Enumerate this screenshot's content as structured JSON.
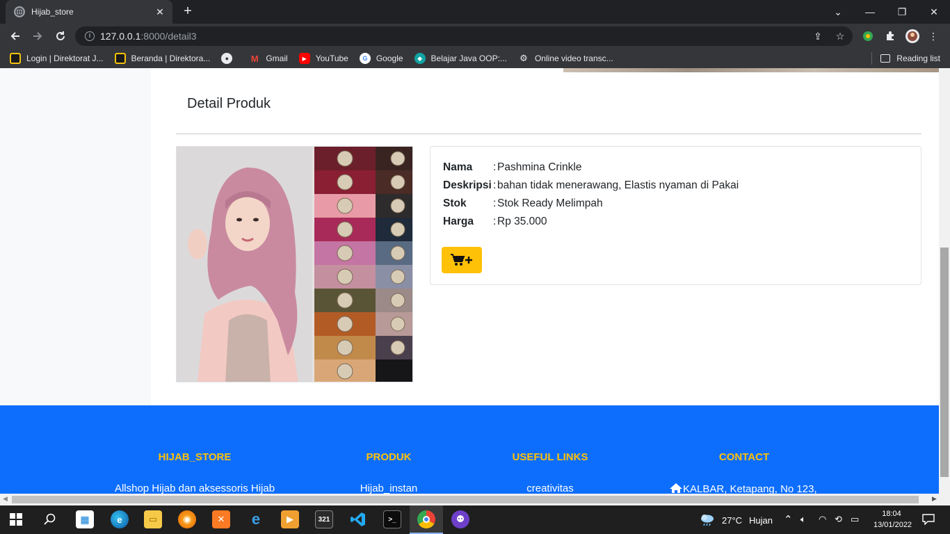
{
  "browser": {
    "tab_title": "Hijab_store",
    "url_host": "127.0.0.1",
    "url_path": ":8000/detail3",
    "bookmarks": [
      {
        "label": "Login | Direktorat J...",
        "color": "#f4c20d"
      },
      {
        "label": "Beranda | Direktora...",
        "color": "#f4c20d"
      },
      {
        "label": "",
        "color": "#e8eaed"
      },
      {
        "label": "Gmail",
        "color": "#ea4335"
      },
      {
        "label": "YouTube",
        "color": "#ff0000"
      },
      {
        "label": "Google",
        "color": "#4285f4"
      },
      {
        "label": "Belajar Java OOP:...",
        "color": "#12a4a4"
      },
      {
        "label": "Online video transc...",
        "color": "#5f6368"
      }
    ],
    "reading_list": "Reading list"
  },
  "page": {
    "section_title": "Detail Produk",
    "product": {
      "rows": [
        {
          "key": "Nama",
          "sep": ":",
          "value": "Pashmina Crinkle"
        },
        {
          "key": "Deskripsi",
          "sep": ":",
          "value": "bahan tidak menerawang, Elastis nyaman di Pakai"
        },
        {
          "key": "Stok",
          "sep": ":",
          "value": "Stok Ready Melimpah"
        },
        {
          "key": "Harga",
          "sep": ":",
          "value": "Rp 35.000"
        }
      ],
      "cart_button_icon": "cart-plus-icon"
    },
    "footer": {
      "columns": [
        {
          "title": "HIJAB_STORE",
          "text": "Allshop Hijab dan aksessoris Hijab"
        },
        {
          "title": "PRODUK",
          "text": "Hijab_instan"
        },
        {
          "title": "USEFUL LINKS",
          "text": "creativitas"
        },
        {
          "title": "CONTACT",
          "text": "KALBAR, Ketapang, No 123,"
        }
      ]
    }
  },
  "taskbar": {
    "weather_temp": "27°C",
    "weather_text": "Hujan",
    "time": "18:04",
    "date": "13/01/2022"
  },
  "colors": {
    "accent": "#0d6efd",
    "warning": "#ffc107"
  }
}
